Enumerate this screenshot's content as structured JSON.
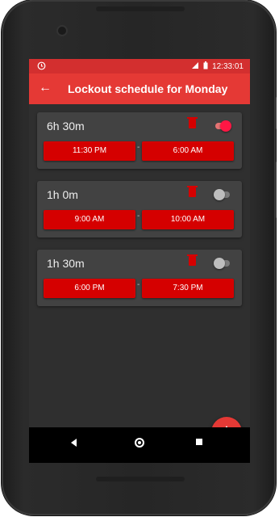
{
  "status_bar": {
    "time": "12:33:01"
  },
  "app_bar": {
    "back_label": "←",
    "title": "Lockout schedule for Monday"
  },
  "schedules": [
    {
      "duration": "6h 30m",
      "start": "11:30 PM",
      "end": "6:00 AM",
      "enabled": true
    },
    {
      "duration": "1h 0m",
      "start": "9:00 AM",
      "end": "10:00 AM",
      "enabled": false
    },
    {
      "duration": "1h 30m",
      "start": "6:00 PM",
      "end": "7:30 PM",
      "enabled": false
    }
  ],
  "separator": "-",
  "fab": {
    "label": "+"
  },
  "colors": {
    "accent": "#e53935",
    "button": "#d50000",
    "card": "#424242",
    "background": "#2f2f2f"
  }
}
